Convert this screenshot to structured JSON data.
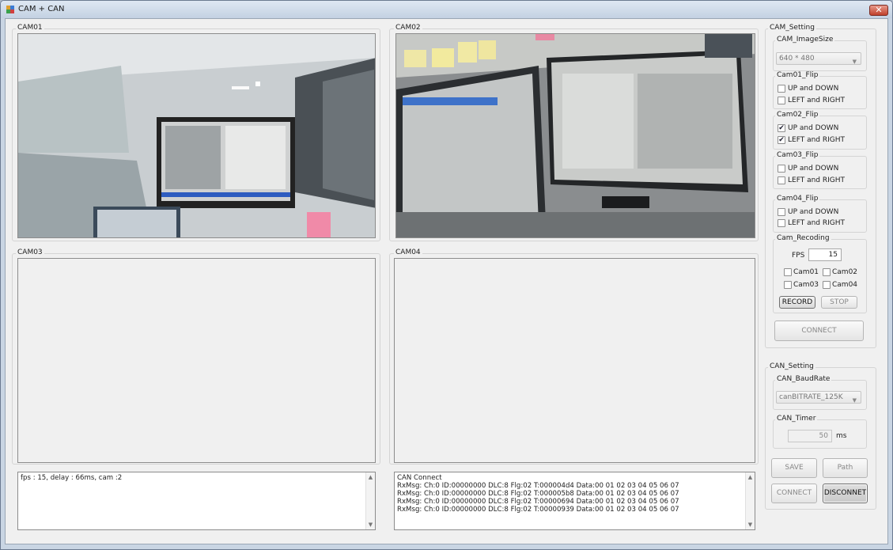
{
  "window": {
    "title": "CAM + CAN",
    "close_glyph": "✕"
  },
  "cams": [
    {
      "label": "CAM01"
    },
    {
      "label": "CAM02"
    },
    {
      "label": "CAM03"
    },
    {
      "label": "CAM04"
    }
  ],
  "cam_log": {
    "lines": [
      "fps :   15, delay :   66ms, cam :2"
    ]
  },
  "can_log": {
    "lines": [
      "CAN Connect",
      "RxMsg: Ch:0 ID:00000000 DLC:8 Flg:02 T:000004d4 Data:00 01 02 03 04 05 06 07",
      "RxMsg: Ch:0 ID:00000000 DLC:8 Flg:02 T:000005b8 Data:00 01 02 03 04 05 06 07",
      "RxMsg: Ch:0 ID:00000000 DLC:8 Flg:02 T:00000694 Data:00 01 02 03 04 05 06 07",
      "RxMsg: Ch:0 ID:00000000 DLC:8 Flg:02 T:00000939 Data:00 01 02 03 04 05 06 07"
    ]
  },
  "cam_setting": {
    "title": "CAM_Setting",
    "image_size": {
      "title": "CAM_ImageSize",
      "value": "640 * 480"
    },
    "flips": [
      {
        "title": "Cam01_Flip",
        "up_down_label": "UP and DOWN",
        "left_right_label": "LEFT and RIGHT",
        "up_down": false,
        "left_right": false
      },
      {
        "title": "Cam02_Flip",
        "up_down_label": "UP and DOWN",
        "left_right_label": "LEFT and RIGHT",
        "up_down": true,
        "left_right": true
      },
      {
        "title": "Cam03_Flip",
        "up_down_label": "UP and DOWN",
        "left_right_label": "LEFT and RIGHT",
        "up_down": false,
        "left_right": false
      },
      {
        "title": "Cam04_Flip",
        "up_down_label": "UP and DOWN",
        "left_right_label": "LEFT and RIGHT",
        "up_down": false,
        "left_right": false
      }
    ],
    "recording": {
      "title": "Cam_Recoding",
      "fps_label": "FPS",
      "fps_value": "15",
      "cams": [
        "Cam01",
        "Cam02",
        "Cam03",
        "Cam04"
      ],
      "record_label": "RECORD",
      "stop_label": "STOP"
    },
    "connect_label": "CONNECT"
  },
  "can_setting": {
    "title": "CAN_Setting",
    "baudrate": {
      "title": "CAN_BaudRate",
      "value": "canBITRATE_125K"
    },
    "timer": {
      "title": "CAN_Timer",
      "value": "50",
      "unit": "ms"
    },
    "save_label": "SAVE",
    "path_label": "Path",
    "connect_label": "CONNECT",
    "disconnect_label": "DISCONNET"
  },
  "icons": {
    "combo_arrow": "▼",
    "scroll_up": "▲",
    "scroll_down": "▼",
    "check": "✔"
  }
}
